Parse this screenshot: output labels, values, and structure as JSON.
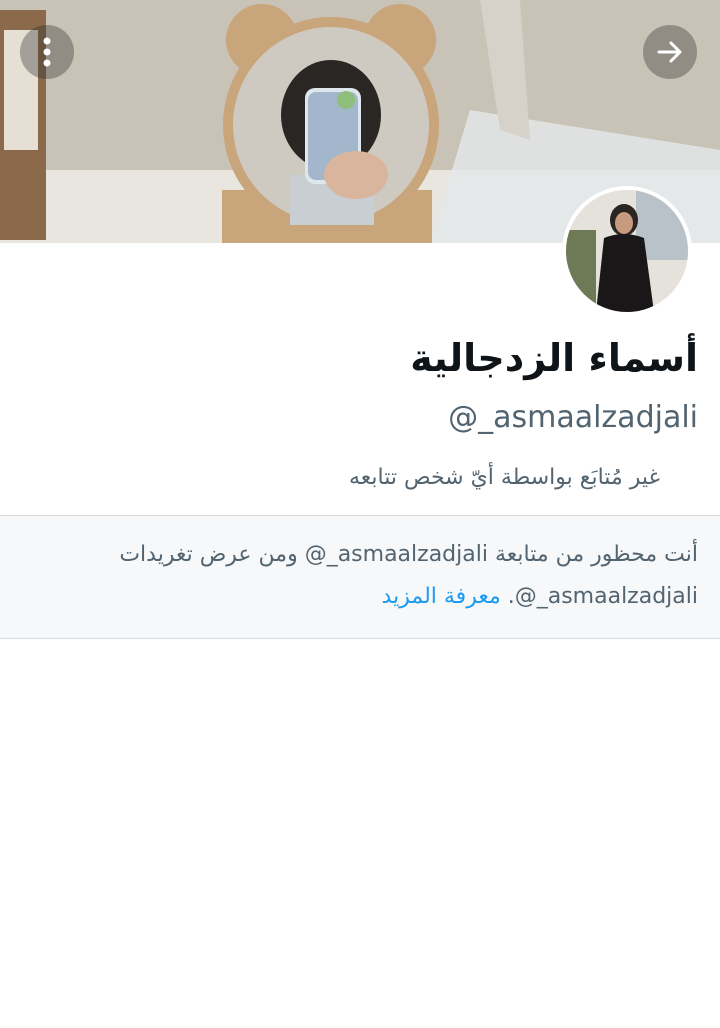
{
  "profile": {
    "display_name": "أسماء الزدجالية",
    "handle": "@_asmaalzadjali",
    "follow_status": "غير مُتابَع بواسطة أيّ شخص تتابعه"
  },
  "blocked_notice": {
    "text": "أنت محظور من متابعة asmaalzadjali_@ ومن عرض تغريدات asmaalzadjali_@.",
    "learn_more": "معرفة المزيد"
  },
  "icons": {
    "more": "more-options-icon",
    "forward": "arrow-right-icon"
  },
  "colors": {
    "accent": "#1d9bf0",
    "text_primary": "#0f1419",
    "text_secondary": "#536471"
  }
}
